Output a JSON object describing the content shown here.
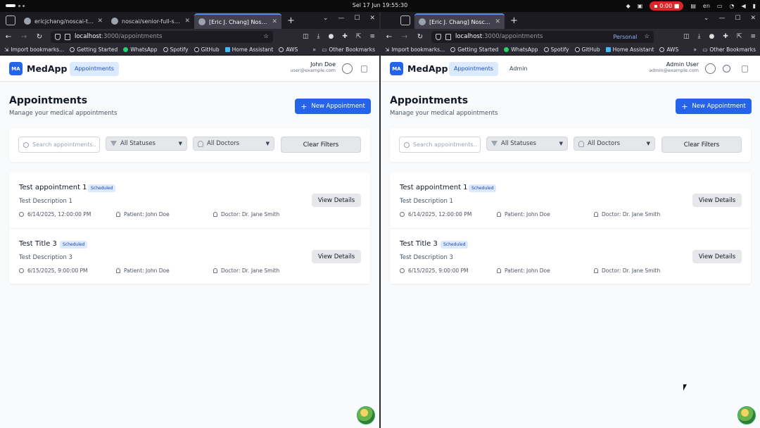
{
  "system": {
    "clock": "Sel 17 Jun  19:55:30",
    "recording": "0:00",
    "lang": "en"
  },
  "left": {
    "tabs": [
      {
        "label": "ericjchang/noscai-test",
        "icon": "github-icon",
        "active": false
      },
      {
        "label": "noscai/senior-full-stack-eng",
        "icon": "github-icon",
        "active": false
      },
      {
        "label": "[Eric J. Chang] NoscAi-Test",
        "icon": "gear-icon",
        "active": true
      }
    ],
    "url": {
      "host": "localhost",
      "path": ":3000/appointments"
    },
    "bookmarks": [
      "Import bookmarks...",
      "Getting Started",
      "WhatsApp",
      "Spotify",
      "GitHub",
      "Home Assistant",
      "AWS"
    ],
    "other_bookmarks": "Other Bookmarks",
    "app": {
      "brand_mark": "MA",
      "brand": "MedApp",
      "nav": [
        "Appointments"
      ],
      "user_name": "John Doe",
      "user_email": "user@example.com",
      "title": "Appointments",
      "subtitle": "Manage your medical appointments",
      "new_button": "New Appointment",
      "search_placeholder": "Search appointments...",
      "status_filter": "All Statuses",
      "doctor_filter": "All Doctors",
      "clear_button": "Clear Filters",
      "appointments": [
        {
          "title": "Test appointment 1",
          "status": "Scheduled",
          "description": "Test Description 1",
          "datetime": "6/14/2025, 12:00:00 PM",
          "patient": "Patient: John Doe",
          "doctor": "Doctor: Dr. Jane Smith",
          "action": "View Details"
        },
        {
          "title": "Test Title 3",
          "status": "Scheduled",
          "description": "Test Description 3",
          "datetime": "6/15/2025, 9:00:00 PM",
          "patient": "Patient: John Doe",
          "doctor": "Doctor: Dr. Jane Smith",
          "action": "View Details"
        }
      ]
    }
  },
  "right": {
    "tabs": [
      {
        "label": "[Eric J. Chang] NoscAi-Test",
        "icon": "gear-icon",
        "active": true
      }
    ],
    "url": {
      "host": "localhost",
      "path": ":3000/appointments",
      "container": "Personal"
    },
    "bookmarks": [
      "Import bookmarks...",
      "Getting Started",
      "WhatsApp",
      "Spotify",
      "GitHub",
      "Home Assistant",
      "AWS"
    ],
    "other_bookmarks": "Other Bookmarks",
    "app": {
      "brand_mark": "MA",
      "brand": "MedApp",
      "nav": [
        "Appointments",
        "Admin"
      ],
      "user_name": "Admin User",
      "user_email": "admin@example.com",
      "title": "Appointments",
      "subtitle": "Manage your medical appointments",
      "new_button": "New Appointment",
      "search_placeholder": "Search appointments...",
      "status_filter": "All Statuses",
      "doctor_filter": "All Doctors",
      "clear_button": "Clear Filters",
      "appointments": [
        {
          "title": "Test appointment 1",
          "status": "Scheduled",
          "description": "Test Description 1",
          "datetime": "6/14/2025, 12:00:00 PM",
          "patient": "Patient: John Doe",
          "doctor": "Doctor: Dr. Jane Smith",
          "action": "View Details"
        },
        {
          "title": "Test Title 3",
          "status": "Scheduled",
          "description": "Test Description 3",
          "datetime": "6/15/2025, 9:00:00 PM",
          "patient": "Patient: John Doe",
          "doctor": "Doctor: Dr. Jane Smith",
          "action": "View Details"
        }
      ]
    }
  }
}
